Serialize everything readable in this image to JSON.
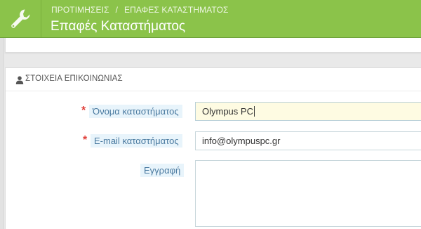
{
  "header": {
    "icon": "wrench-icon",
    "breadcrumb": [
      "ΠΡΟΤΙΜΗΣΕΙΣ",
      "ΕΠΑΦΕΣ ΚΑΤΑΣΤΗΜΑΤΟΣ"
    ],
    "breadcrumb_separator": "/",
    "title": "Επαφές Καταστήματος",
    "background_color": "#8bc34a"
  },
  "contact_panel": {
    "icon": "user-icon",
    "heading": "ΣΤΟΙΧΕΙΑ ΕΠΙΚΟΙΝΩΝΙΑΣ",
    "fields": [
      {
        "label": "Όνομα καταστήματος",
        "required": true,
        "value": "Olympus PC",
        "focused": true
      },
      {
        "label": "E-mail καταστήματος",
        "required": true,
        "value": "info@olympuspc.gr",
        "focused": false
      },
      {
        "label": "Εγγραφή",
        "required": false,
        "value": "",
        "focused": false
      }
    ],
    "required_marker": "*"
  }
}
